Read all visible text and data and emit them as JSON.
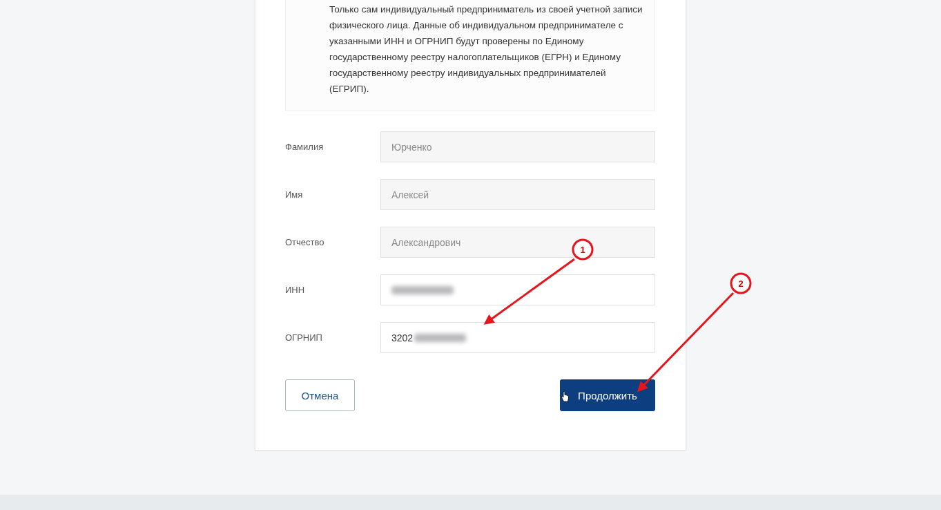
{
  "notice": {
    "text": "Только сам индивидуальный предприниматель из своей учетной записи физического лица. Данные об индивидуальном предпринимателе с указанными ИНН и ОГРНИП будут проверены по Единому государственному реестру налогоплательщиков (ЕГРН) и Единому государственному реестру индивидуальных предпринимателей (ЕГРИП)."
  },
  "fields": [
    {
      "label": "Фамилия",
      "value": "Юрченко",
      "disabled": true,
      "redacted": false
    },
    {
      "label": "Имя",
      "value": "Алексей",
      "disabled": true,
      "redacted": false
    },
    {
      "label": "Отчество",
      "value": "Александрович",
      "disabled": true,
      "redacted": false
    },
    {
      "label": "ИНН",
      "disabled": false,
      "redacted": true
    },
    {
      "label": "ОГРНИП",
      "value": "3202",
      "disabled": false,
      "redacted": true
    }
  ],
  "buttons": [
    {
      "label": "Отмена",
      "kind": "secondary"
    },
    {
      "label": "Продолжить",
      "kind": "primary"
    }
  ],
  "annotations": [
    {
      "label": "1"
    },
    {
      "label": "2"
    }
  ]
}
